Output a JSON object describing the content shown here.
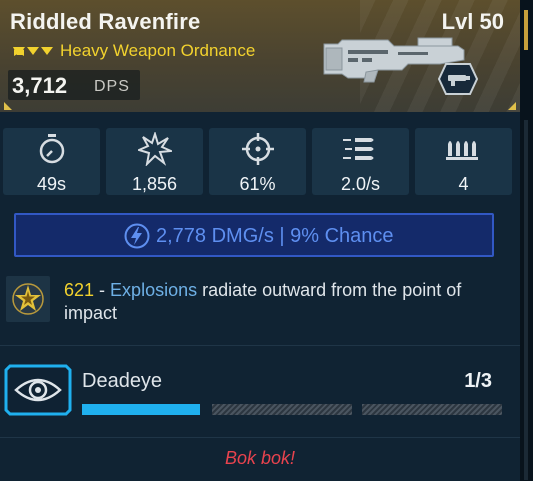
{
  "weapon": {
    "name": "Riddled Ravenfire",
    "level": "Lvl 50",
    "type": "Heavy Weapon Ordnance",
    "dps_value": "3,712",
    "dps_label": "DPS",
    "rarity_icon": "triple-chevron-icon",
    "image_icon": "launcher-weapon-icon",
    "ammo_icon": "heavy-ammo-icon"
  },
  "stats": [
    {
      "icon": "reload-timer-icon",
      "value": "49s"
    },
    {
      "icon": "damage-burst-icon",
      "value": "1,856"
    },
    {
      "icon": "accuracy-crosshair-icon",
      "value": "61%"
    },
    {
      "icon": "fire-rate-icon",
      "value": "2.0/s"
    },
    {
      "icon": "magazine-icon",
      "value": "4"
    }
  ],
  "element": {
    "icon": "lightning-bolt-icon",
    "text": "2,778 DMG/s | 9% Chance"
  },
  "perk": {
    "icon": "explosion-star-icon",
    "number": "621",
    "separator": " - ",
    "keyword": "Explosions",
    "rest": " radiate outward from the point of impact"
  },
  "mod": {
    "icon": "eye-target-icon",
    "name": "Deadeye",
    "count": "1/3",
    "progress_filled_segments": 1,
    "progress_total_segments": 3
  },
  "flavor_text": "Bok bok!",
  "colors": {
    "accent_yellow": "#f2d22e",
    "progress_blue": "#1fb0ef",
    "element_blue": "#5e8ff0",
    "keyword_blue": "#6eb0e6",
    "flavor_red": "#e8434e"
  }
}
